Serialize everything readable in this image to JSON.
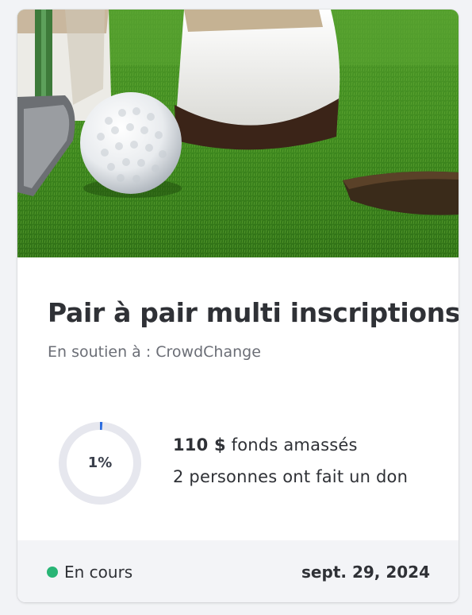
{
  "campaign": {
    "image_alt": "golf-putt-photo",
    "title": "Pair à pair multi inscriptions",
    "subtitle": "En soutien à : CrowdChange"
  },
  "progress": {
    "percent_label": "1%",
    "percent_value": 1,
    "color": "#2b6cdf",
    "track_color": "#e6e7ee"
  },
  "stats": {
    "amount": "110 $",
    "amount_suffix": " fonds amassés",
    "donors": "2 personnes ont fait un don"
  },
  "footer": {
    "status_label": "En cours",
    "status_color": "#28b576",
    "date": "sept. 29, 2024"
  }
}
